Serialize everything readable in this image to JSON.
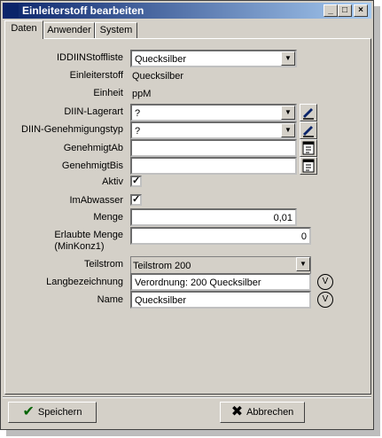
{
  "window": {
    "title": "Einleiterstoff bearbeiten"
  },
  "tabs": [
    {
      "label": "Daten",
      "active": true
    },
    {
      "label": "Anwender"
    },
    {
      "label": "System"
    }
  ],
  "form": {
    "iddiinstoffliste": {
      "label": "IDDIINStoffliste",
      "value": "Quecksilber"
    },
    "einleiterstoff": {
      "label": "Einleiterstoff",
      "value": "Quecksilber"
    },
    "einheit": {
      "label": "Einheit",
      "value": "ppM"
    },
    "lagerart": {
      "label": "DIIN-Lagerart",
      "value": "?"
    },
    "genehmigungstyp": {
      "label": "DIIN-Genehmigungstyp",
      "value": "?"
    },
    "genehmigtab": {
      "label": "GenehmigtAb",
      "value": ""
    },
    "genehmigtbis": {
      "label": "GenehmigtBis",
      "value": ""
    },
    "aktiv": {
      "label": "Aktiv",
      "checked": true
    },
    "imabwasser": {
      "label": "ImAbwasser",
      "checked": true
    },
    "menge": {
      "label": "Menge",
      "value": "0,01"
    },
    "erlaubte_menge": {
      "label_line1": "Erlaubte Menge",
      "label_line2": "(MinKonz1)",
      "value": "0"
    },
    "teilstrom": {
      "label": "Teilstrom",
      "value": "Teilstrom 200"
    },
    "langbezeichnung": {
      "label": "Langbezeichnung",
      "value": "Verordnung: 200 Quecksilber"
    },
    "name": {
      "label": "Name",
      "value": "Quecksilber"
    },
    "v_icon_text": "V"
  },
  "buttons": {
    "save": "Speichern",
    "cancel": "Abbrechen"
  },
  "icons": {
    "dropdown": "chevron-down-icon",
    "edit": "pen-icon",
    "calendar": "calendar-icon"
  }
}
